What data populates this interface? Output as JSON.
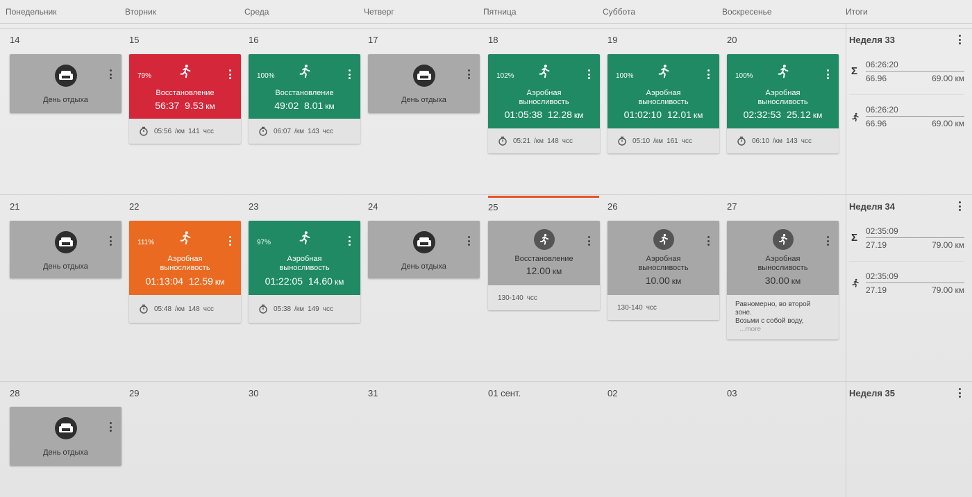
{
  "header": {
    "days": [
      "Понедельник",
      "Вторник",
      "Среда",
      "Четверг",
      "Пятница",
      "Суббота",
      "Воскресенье"
    ],
    "totals": "Итоги"
  },
  "colors": {
    "red": "#d4273a",
    "green": "#1f8a63",
    "orange": "#ea6a22",
    "gray": "#a7a7a7",
    "today": "#e8542b"
  },
  "rows": [
    {
      "dates": [
        "14",
        "15",
        "16",
        "17",
        "18",
        "19",
        "20"
      ],
      "week": {
        "title": "Неделя 33",
        "total_time": "06:26:20",
        "total_a": "66.96",
        "total_b": "69.00 км",
        "run_time": "06:26:20",
        "run_a": "66.96",
        "run_b": "69.00 км"
      },
      "cards": {
        "mon": {
          "label": "День отдыха"
        },
        "tue": {
          "pct": "79%",
          "title": "Восстановление",
          "time": "56:37",
          "dist": "9.53",
          "unit": "км",
          "pace": "05:56",
          "pace_unit": "/км",
          "hr": "141",
          "hr_unit": "чсс"
        },
        "wed": {
          "pct": "100%",
          "title": "Восстановление",
          "time": "49:02",
          "dist": "8.01",
          "unit": "км",
          "pace": "06:07",
          "pace_unit": "/км",
          "hr": "143",
          "hr_unit": "чсс"
        },
        "thu": {
          "label": "День отдыха"
        },
        "fri": {
          "pct": "102%",
          "title1": "Аэробная",
          "title2": "выносливость",
          "time": "01:05:38",
          "dist": "12.28",
          "unit": "км",
          "pace": "05:21",
          "pace_unit": "/км",
          "hr": "148",
          "hr_unit": "чсс"
        },
        "sat": {
          "pct": "100%",
          "title1": "Аэробная",
          "title2": "выносливость",
          "time": "01:02:10",
          "dist": "12.01",
          "unit": "км",
          "pace": "05:10",
          "pace_unit": "/км",
          "hr": "161",
          "hr_unit": "чсс"
        },
        "sun": {
          "pct": "100%",
          "title1": "Аэробная",
          "title2": "выносливость",
          "time": "02:32:53",
          "dist": "25.12",
          "unit": "км",
          "pace": "06:10",
          "pace_unit": "/км",
          "hr": "143",
          "hr_unit": "чсс"
        }
      }
    },
    {
      "dates": [
        "21",
        "22",
        "23",
        "24",
        "25",
        "26",
        "27"
      ],
      "week": {
        "title": "Неделя 34",
        "total_time": "02:35:09",
        "total_a": "27.19",
        "total_b": "79.00 км",
        "run_time": "02:35:09",
        "run_a": "27.19",
        "run_b": "79.00 км"
      },
      "cards": {
        "mon": {
          "label": "День отдыха"
        },
        "tue": {
          "pct": "111%",
          "title1": "Аэробная",
          "title2": "выносливость",
          "time": "01:13:04",
          "dist": "12.59",
          "unit": "км",
          "pace": "05:48",
          "pace_unit": "/км",
          "hr": "148",
          "hr_unit": "чсс"
        },
        "wed": {
          "pct": "97%",
          "title1": "Аэробная",
          "title2": "выносливость",
          "time": "01:22:05",
          "dist": "14.60",
          "unit": "км",
          "pace": "05:38",
          "pace_unit": "/км",
          "hr": "149",
          "hr_unit": "чсс"
        },
        "thu": {
          "label": "День отдыха"
        },
        "fri": {
          "title": "Восстановление",
          "dist": "12.00",
          "unit": "км",
          "hr_range": "130-140",
          "hr_unit": "чсс"
        },
        "sat": {
          "title1": "Аэробная",
          "title2": "выносливость",
          "dist": "10.00",
          "unit": "км",
          "hr_range": "130-140",
          "hr_unit": "чсс"
        },
        "sun": {
          "title1": "Аэробная",
          "title2": "выносливость",
          "dist": "30.00",
          "unit": "км",
          "note1": "Равномерно, во второй",
          "note2": "зоне.",
          "note3": "Возьми с собой воду,",
          "more": "...more"
        }
      }
    },
    {
      "dates": [
        "28",
        "29",
        "30",
        "31",
        "01 сент.",
        "02",
        "03"
      ],
      "week": {
        "title": "Неделя 35"
      },
      "cards": {
        "mon": {
          "label": "День отдыха"
        }
      }
    }
  ]
}
